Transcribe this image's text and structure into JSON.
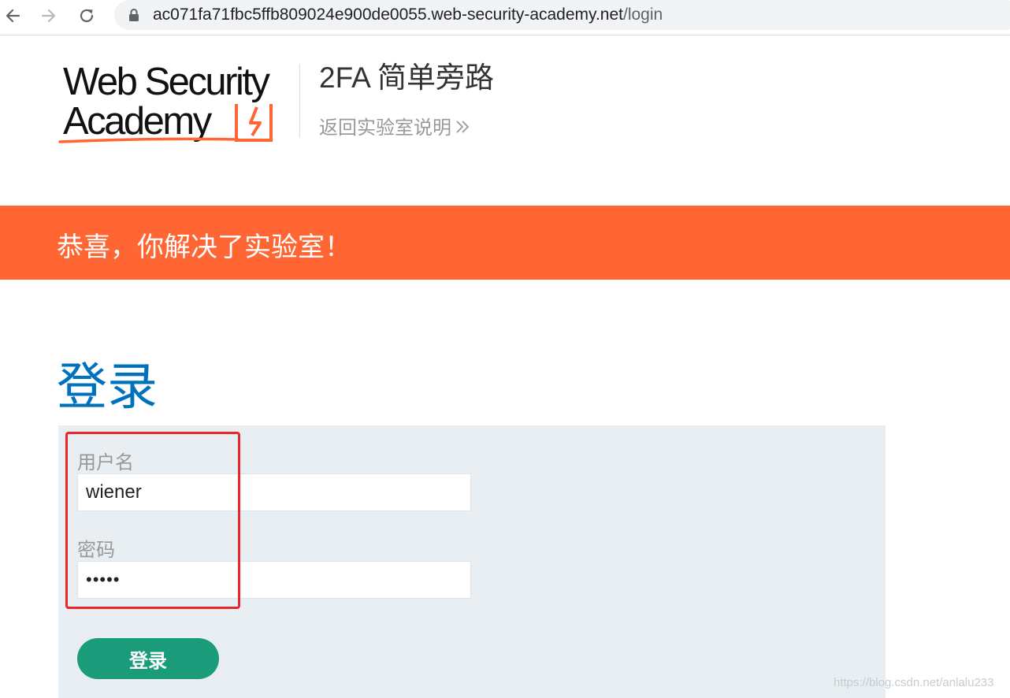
{
  "browser": {
    "url_host": "ac071fa71fbc5ffb809024e900de0055.web-security-academy.net",
    "url_path": "/login"
  },
  "header": {
    "logo_line1": "Web Security",
    "logo_line2": "Academy",
    "lab_title": "2FA 简单旁路",
    "back_link": "返回实验室说明",
    "back_link_icon": "double-chevron-right-icon"
  },
  "banner": {
    "text": "恭喜，你解决了实验室！",
    "color": "#ff6633"
  },
  "login": {
    "heading": "登录",
    "username_label": "用户名",
    "username_value": "wiener",
    "password_label": "密码",
    "password_value": "peter",
    "submit_label": "登录",
    "button_color": "#1a9c7b",
    "heading_color": "#0071bc"
  },
  "watermark": "https://blog.csdn.net/anlalu233"
}
